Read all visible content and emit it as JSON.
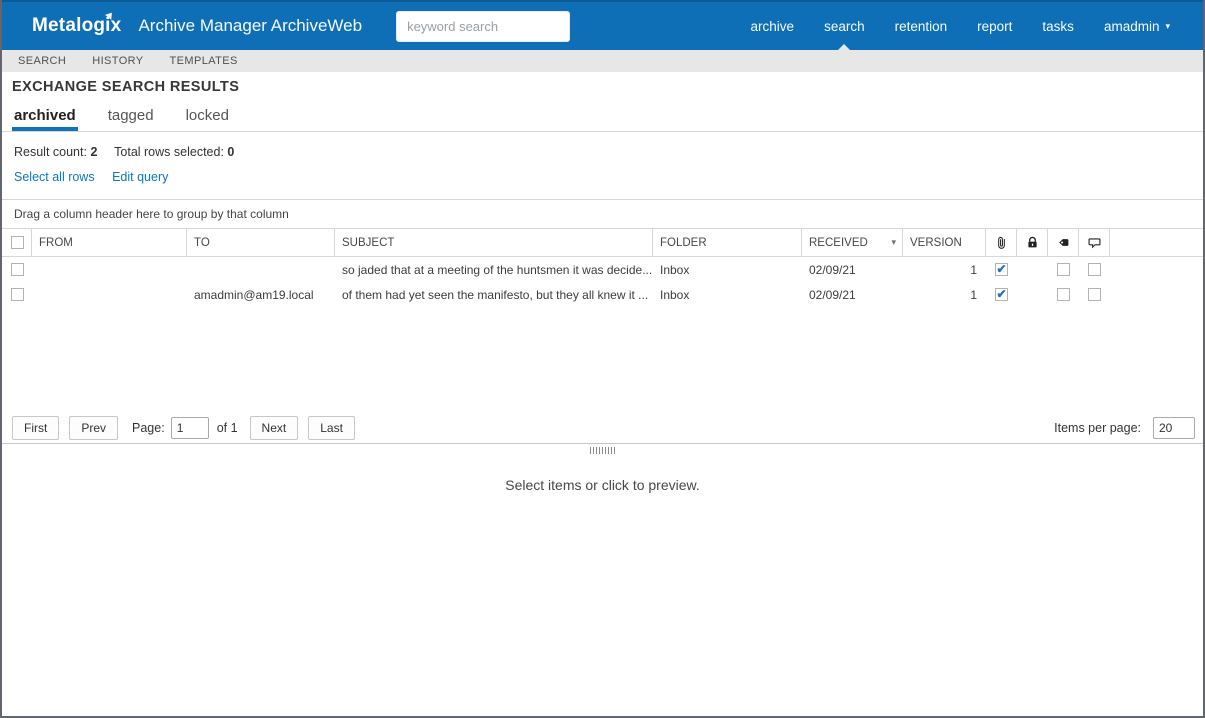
{
  "colors": {
    "header_blue": "#0e6fb6",
    "accent_blue": "#1173ba",
    "link_blue": "#0e76bd",
    "check_blue": "#1f73b9"
  },
  "header": {
    "logo": "Metalogix",
    "app_title": "Archive Manager ArchiveWeb",
    "search_placeholder": "keyword search",
    "nav": [
      {
        "label": "archive",
        "active": false
      },
      {
        "label": "search",
        "active": true
      },
      {
        "label": "retention",
        "active": false
      },
      {
        "label": "report",
        "active": false
      },
      {
        "label": "tasks",
        "active": false
      }
    ],
    "user": {
      "label": "amadmin",
      "icon": "caret-down-icon"
    }
  },
  "subnav": {
    "items": [
      {
        "label": "SEARCH"
      },
      {
        "label": "HISTORY"
      },
      {
        "label": "TEMPLATES"
      }
    ]
  },
  "page": {
    "title": "EXCHANGE SEARCH RESULTS"
  },
  "tabs": [
    {
      "label": "archived",
      "active": true
    },
    {
      "label": "tagged",
      "active": false
    },
    {
      "label": "locked",
      "active": false
    }
  ],
  "results": {
    "count_label": "Result count:",
    "count": "2",
    "selected_label": "Total rows selected:",
    "selected": "0",
    "select_all": "Select all rows",
    "edit_query": "Edit query",
    "group_hint": "Drag a column header here to group by that column"
  },
  "table": {
    "columns": {
      "from": "FROM",
      "to": "TO",
      "subject": "SUBJECT",
      "folder": "FOLDER",
      "received": "RECEIVED",
      "version": "VERSION"
    },
    "icon_columns": [
      "attachment",
      "lock",
      "tag",
      "comment"
    ],
    "rows": [
      {
        "from": "",
        "to": "",
        "subject": "so jaded that at a meeting of the huntsmen it was decide...",
        "folder": "Inbox",
        "received": "02/09/21",
        "version": "1",
        "attachment": true,
        "locked": false,
        "tagged": false,
        "commented": false
      },
      {
        "from": "",
        "to": "amadmin@am19.local",
        "subject": "of them had yet seen the manifesto, but they all knew it ...",
        "folder": "Inbox",
        "received": "02/09/21",
        "version": "1",
        "attachment": true,
        "locked": false,
        "tagged": false,
        "commented": false
      }
    ]
  },
  "pagination": {
    "first": "First",
    "prev": "Prev",
    "page_label": "Page:",
    "page_value": "1",
    "of_label": "of 1",
    "next": "Next",
    "last": "Last",
    "items_per_page_label": "Items per page:",
    "items_per_page": "20"
  },
  "preview": {
    "message": "Select items or click to preview."
  }
}
